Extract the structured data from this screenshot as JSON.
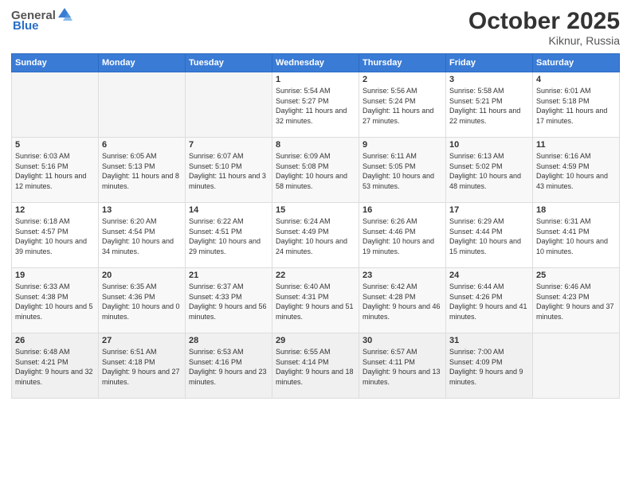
{
  "header": {
    "logo_general": "General",
    "logo_blue": "Blue",
    "month_year": "October 2025",
    "location": "Kiknur, Russia"
  },
  "days_of_week": [
    "Sunday",
    "Monday",
    "Tuesday",
    "Wednesday",
    "Thursday",
    "Friday",
    "Saturday"
  ],
  "weeks": [
    [
      {
        "day": "",
        "info": ""
      },
      {
        "day": "",
        "info": ""
      },
      {
        "day": "",
        "info": ""
      },
      {
        "day": "1",
        "info": "Sunrise: 5:54 AM\nSunset: 5:27 PM\nDaylight: 11 hours\nand 32 minutes."
      },
      {
        "day": "2",
        "info": "Sunrise: 5:56 AM\nSunset: 5:24 PM\nDaylight: 11 hours\nand 27 minutes."
      },
      {
        "day": "3",
        "info": "Sunrise: 5:58 AM\nSunset: 5:21 PM\nDaylight: 11 hours\nand 22 minutes."
      },
      {
        "day": "4",
        "info": "Sunrise: 6:01 AM\nSunset: 5:18 PM\nDaylight: 11 hours\nand 17 minutes."
      }
    ],
    [
      {
        "day": "5",
        "info": "Sunrise: 6:03 AM\nSunset: 5:16 PM\nDaylight: 11 hours\nand 12 minutes."
      },
      {
        "day": "6",
        "info": "Sunrise: 6:05 AM\nSunset: 5:13 PM\nDaylight: 11 hours\nand 8 minutes."
      },
      {
        "day": "7",
        "info": "Sunrise: 6:07 AM\nSunset: 5:10 PM\nDaylight: 11 hours\nand 3 minutes."
      },
      {
        "day": "8",
        "info": "Sunrise: 6:09 AM\nSunset: 5:08 PM\nDaylight: 10 hours\nand 58 minutes."
      },
      {
        "day": "9",
        "info": "Sunrise: 6:11 AM\nSunset: 5:05 PM\nDaylight: 10 hours\nand 53 minutes."
      },
      {
        "day": "10",
        "info": "Sunrise: 6:13 AM\nSunset: 5:02 PM\nDaylight: 10 hours\nand 48 minutes."
      },
      {
        "day": "11",
        "info": "Sunrise: 6:16 AM\nSunset: 4:59 PM\nDaylight: 10 hours\nand 43 minutes."
      }
    ],
    [
      {
        "day": "12",
        "info": "Sunrise: 6:18 AM\nSunset: 4:57 PM\nDaylight: 10 hours\nand 39 minutes."
      },
      {
        "day": "13",
        "info": "Sunrise: 6:20 AM\nSunset: 4:54 PM\nDaylight: 10 hours\nand 34 minutes."
      },
      {
        "day": "14",
        "info": "Sunrise: 6:22 AM\nSunset: 4:51 PM\nDaylight: 10 hours\nand 29 minutes."
      },
      {
        "day": "15",
        "info": "Sunrise: 6:24 AM\nSunset: 4:49 PM\nDaylight: 10 hours\nand 24 minutes."
      },
      {
        "day": "16",
        "info": "Sunrise: 6:26 AM\nSunset: 4:46 PM\nDaylight: 10 hours\nand 19 minutes."
      },
      {
        "day": "17",
        "info": "Sunrise: 6:29 AM\nSunset: 4:44 PM\nDaylight: 10 hours\nand 15 minutes."
      },
      {
        "day": "18",
        "info": "Sunrise: 6:31 AM\nSunset: 4:41 PM\nDaylight: 10 hours\nand 10 minutes."
      }
    ],
    [
      {
        "day": "19",
        "info": "Sunrise: 6:33 AM\nSunset: 4:38 PM\nDaylight: 10 hours\nand 5 minutes."
      },
      {
        "day": "20",
        "info": "Sunrise: 6:35 AM\nSunset: 4:36 PM\nDaylight: 10 hours\nand 0 minutes."
      },
      {
        "day": "21",
        "info": "Sunrise: 6:37 AM\nSunset: 4:33 PM\nDaylight: 9 hours\nand 56 minutes."
      },
      {
        "day": "22",
        "info": "Sunrise: 6:40 AM\nSunset: 4:31 PM\nDaylight: 9 hours\nand 51 minutes."
      },
      {
        "day": "23",
        "info": "Sunrise: 6:42 AM\nSunset: 4:28 PM\nDaylight: 9 hours\nand 46 minutes."
      },
      {
        "day": "24",
        "info": "Sunrise: 6:44 AM\nSunset: 4:26 PM\nDaylight: 9 hours\nand 41 minutes."
      },
      {
        "day": "25",
        "info": "Sunrise: 6:46 AM\nSunset: 4:23 PM\nDaylight: 9 hours\nand 37 minutes."
      }
    ],
    [
      {
        "day": "26",
        "info": "Sunrise: 6:48 AM\nSunset: 4:21 PM\nDaylight: 9 hours\nand 32 minutes."
      },
      {
        "day": "27",
        "info": "Sunrise: 6:51 AM\nSunset: 4:18 PM\nDaylight: 9 hours\nand 27 minutes."
      },
      {
        "day": "28",
        "info": "Sunrise: 6:53 AM\nSunset: 4:16 PM\nDaylight: 9 hours\nand 23 minutes."
      },
      {
        "day": "29",
        "info": "Sunrise: 6:55 AM\nSunset: 4:14 PM\nDaylight: 9 hours\nand 18 minutes."
      },
      {
        "day": "30",
        "info": "Sunrise: 6:57 AM\nSunset: 4:11 PM\nDaylight: 9 hours\nand 13 minutes."
      },
      {
        "day": "31",
        "info": "Sunrise: 7:00 AM\nSunset: 4:09 PM\nDaylight: 9 hours\nand 9 minutes."
      },
      {
        "day": "",
        "info": ""
      }
    ]
  ]
}
